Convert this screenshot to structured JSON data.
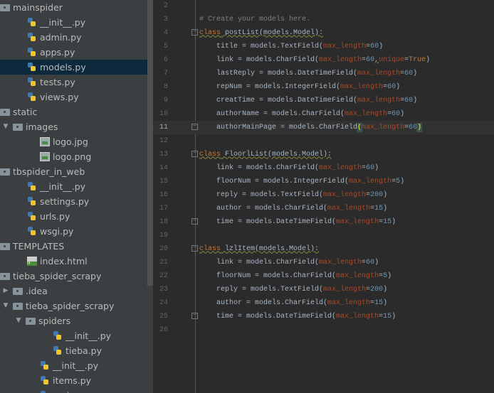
{
  "sidebar": {
    "items": [
      {
        "label": "mainspider",
        "icon": "folder",
        "level": 0
      },
      {
        "label": "__init__.py",
        "icon": "python-file",
        "level": 1
      },
      {
        "label": "admin.py",
        "icon": "python-file",
        "level": 1
      },
      {
        "label": "apps.py",
        "icon": "python-file",
        "level": 1
      },
      {
        "label": "models.py",
        "icon": "python-file",
        "level": 1,
        "selected": true
      },
      {
        "label": "tests.py",
        "icon": "python-file",
        "level": 1
      },
      {
        "label": "views.py",
        "icon": "python-file",
        "level": 1
      },
      {
        "label": "static",
        "icon": "folder",
        "level": 0
      },
      {
        "label": "images",
        "icon": "folder",
        "level": 1,
        "expanded": true
      },
      {
        "label": "logo.jpg",
        "icon": "image-file",
        "level": 2
      },
      {
        "label": "logo.png",
        "icon": "image-file",
        "level": 2
      },
      {
        "label": "tbspider_in_web",
        "icon": "folder",
        "level": 0
      },
      {
        "label": "__init__.py",
        "icon": "python-file",
        "level": 1
      },
      {
        "label": "settings.py",
        "icon": "python-file",
        "level": 1
      },
      {
        "label": "urls.py",
        "icon": "python-file",
        "level": 1
      },
      {
        "label": "wsgi.py",
        "icon": "python-file",
        "level": 1
      },
      {
        "label": "TEMPLATES",
        "icon": "folder",
        "level": 0
      },
      {
        "label": "index.html",
        "icon": "html-file",
        "level": 1
      },
      {
        "label": "tieba_spider_scrapy",
        "icon": "folder",
        "level": 0
      },
      {
        "label": ".idea",
        "icon": "folder",
        "level": 1,
        "expanded": false
      },
      {
        "label": "tieba_spider_scrapy",
        "icon": "folder",
        "level": 1,
        "expanded": true
      },
      {
        "label": "spiders",
        "icon": "folder",
        "level": 2,
        "expanded": true
      },
      {
        "label": "__init__.py",
        "icon": "python-file",
        "level": 3
      },
      {
        "label": "tieba.py",
        "icon": "python-file",
        "level": 3
      },
      {
        "label": "__init__.py",
        "icon": "python-file",
        "level": 2
      },
      {
        "label": "items.py",
        "icon": "python-file",
        "level": 2
      },
      {
        "label": "main.py",
        "icon": "python-file",
        "level": 2
      }
    ]
  },
  "editor": {
    "current_line": 11,
    "lines": [
      {
        "n": "2",
        "t": []
      },
      {
        "n": "3",
        "t": [
          [
            "# Create your models here.",
            "cm"
          ]
        ]
      },
      {
        "n": "4",
        "fold": true,
        "t": [
          [
            "class",
            "kw w"
          ],
          [
            " postList(models.Model):",
            "w"
          ]
        ]
      },
      {
        "n": "5",
        "t": [
          [
            "    title = models.TextField(",
            ""
          ],
          [
            "max_length",
            "arg"
          ],
          [
            "=",
            ""
          ],
          [
            "60",
            "num"
          ],
          [
            ")",
            ""
          ]
        ]
      },
      {
        "n": "6",
        "t": [
          [
            "    link = models.CharField(",
            ""
          ],
          [
            "max_length",
            "arg"
          ],
          [
            "=",
            ""
          ],
          [
            "60",
            "num"
          ],
          [
            ",",
            "w"
          ],
          [
            "unique",
            "arg"
          ],
          [
            "=",
            ""
          ],
          [
            "True",
            "true"
          ],
          [
            ")",
            ""
          ]
        ]
      },
      {
        "n": "7",
        "t": [
          [
            "    lastReply = models.DateTimeField(",
            ""
          ],
          [
            "max_length",
            "arg"
          ],
          [
            "=",
            ""
          ],
          [
            "60",
            "num"
          ],
          [
            ")",
            ""
          ]
        ]
      },
      {
        "n": "8",
        "t": [
          [
            "    repNum = models.IntegerField(",
            ""
          ],
          [
            "max_length",
            "arg"
          ],
          [
            "=",
            ""
          ],
          [
            "60",
            "num"
          ],
          [
            ")",
            ""
          ]
        ]
      },
      {
        "n": "9",
        "t": [
          [
            "    creatTime = models.DateTimeField(",
            ""
          ],
          [
            "max_length",
            "arg"
          ],
          [
            "=",
            ""
          ],
          [
            "60",
            "num"
          ],
          [
            ")",
            ""
          ]
        ]
      },
      {
        "n": "10",
        "t": [
          [
            "    authorName = models.CharField(",
            ""
          ],
          [
            "max_length",
            "arg"
          ],
          [
            "=",
            ""
          ],
          [
            "60",
            "num"
          ],
          [
            ")",
            ""
          ]
        ]
      },
      {
        "n": "11",
        "fold": true,
        "t": [
          [
            "    authorMainPage = models.CharField",
            ""
          ],
          [
            "(",
            "brk"
          ],
          [
            "max_length",
            "arg"
          ],
          [
            "=",
            ""
          ],
          [
            "60",
            "num"
          ],
          [
            ")",
            "brk"
          ]
        ]
      },
      {
        "n": "12",
        "t": []
      },
      {
        "n": "13",
        "fold": true,
        "t": [
          [
            "class",
            "kw w"
          ],
          [
            " FloorlList(models.Model):",
            "w"
          ]
        ]
      },
      {
        "n": "14",
        "t": [
          [
            "    link = models.CharField(",
            ""
          ],
          [
            "max_length",
            "arg"
          ],
          [
            "=",
            ""
          ],
          [
            "60",
            "num"
          ],
          [
            ")",
            ""
          ]
        ]
      },
      {
        "n": "15",
        "t": [
          [
            "    floorNum = models.IntegerField(",
            ""
          ],
          [
            "max_length",
            "arg"
          ],
          [
            "=",
            ""
          ],
          [
            "5",
            "num"
          ],
          [
            ")",
            ""
          ]
        ]
      },
      {
        "n": "16",
        "t": [
          [
            "    reply = models.TextField(",
            ""
          ],
          [
            "max_length",
            "arg"
          ],
          [
            "=",
            ""
          ],
          [
            "200",
            "num"
          ],
          [
            ")",
            ""
          ]
        ]
      },
      {
        "n": "17",
        "t": [
          [
            "    author = models.CharField(",
            ""
          ],
          [
            "max_length",
            "arg"
          ],
          [
            "=",
            ""
          ],
          [
            "15",
            "num"
          ],
          [
            ")",
            ""
          ]
        ]
      },
      {
        "n": "18",
        "fold": true,
        "t": [
          [
            "    time = models.DateTimeField(",
            ""
          ],
          [
            "max_length",
            "arg"
          ],
          [
            "=",
            ""
          ],
          [
            "15",
            "num"
          ],
          [
            ")",
            ""
          ]
        ]
      },
      {
        "n": "19",
        "t": []
      },
      {
        "n": "20",
        "fold": true,
        "t": [
          [
            "class",
            "kw w"
          ],
          [
            " lzlItem(models.Model):",
            "w"
          ]
        ]
      },
      {
        "n": "21",
        "t": [
          [
            "    link = models.CharField(",
            ""
          ],
          [
            "max_length",
            "arg"
          ],
          [
            "=",
            ""
          ],
          [
            "60",
            "num"
          ],
          [
            ")",
            ""
          ]
        ]
      },
      {
        "n": "22",
        "t": [
          [
            "    floorNum = models.CharField(",
            ""
          ],
          [
            "max_length",
            "arg"
          ],
          [
            "=",
            ""
          ],
          [
            "5",
            "num"
          ],
          [
            ")",
            ""
          ]
        ]
      },
      {
        "n": "23",
        "t": [
          [
            "    reply = models.TextField(",
            ""
          ],
          [
            "max_length",
            "arg"
          ],
          [
            "=",
            ""
          ],
          [
            "200",
            "num"
          ],
          [
            ")",
            ""
          ]
        ]
      },
      {
        "n": "24",
        "t": [
          [
            "    author = models.CharField(",
            ""
          ],
          [
            "max_length",
            "arg"
          ],
          [
            "=",
            ""
          ],
          [
            "15",
            "num"
          ],
          [
            ")",
            ""
          ]
        ]
      },
      {
        "n": "25",
        "fold": true,
        "t": [
          [
            "    time = models.DateTimeField(",
            ""
          ],
          [
            "max_length",
            "arg"
          ],
          [
            "=",
            ""
          ],
          [
            "15",
            "num"
          ],
          [
            ")",
            ""
          ]
        ]
      },
      {
        "n": "26",
        "t": []
      }
    ]
  },
  "colors": {
    "sidebar_bg": "#3c3f41",
    "editor_bg": "#2b2b2b",
    "selection": "#0d293e",
    "keyword": "#cc7832",
    "kwarg": "#aa4926",
    "number": "#6897bb"
  }
}
